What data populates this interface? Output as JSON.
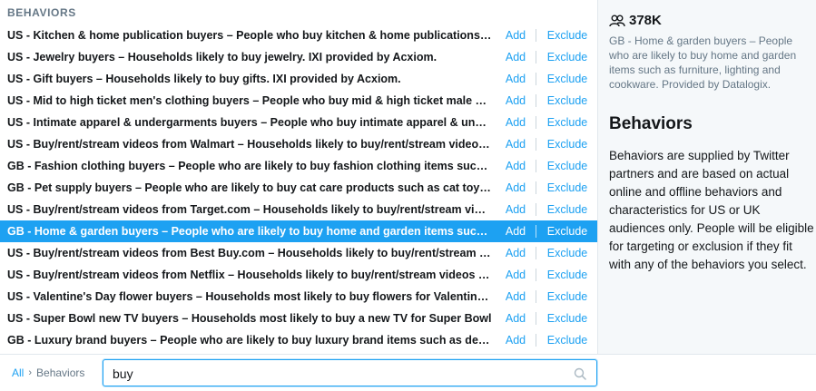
{
  "section": {
    "title": "BEHAVIORS"
  },
  "rows": [
    {
      "label": "US - Kitchen & home publication buyers – People who buy kitchen & home publications including cooking magazines",
      "add": "Add",
      "exclude": "Exclude",
      "selected": false
    },
    {
      "label": "US - Jewelry buyers – Households likely to buy jewelry. IXI provided by Acxiom.",
      "add": "Add",
      "exclude": "Exclude",
      "selected": false
    },
    {
      "label": "US - Gift buyers – Households likely to buy gifts. IXI provided by Acxiom.",
      "add": "Add",
      "exclude": "Exclude",
      "selected": false
    },
    {
      "label": "US - Mid to high ticket men's clothing buyers – People who buy mid & high ticket male clothing",
      "add": "Add",
      "exclude": "Exclude",
      "selected": false
    },
    {
      "label": "US - Intimate apparel & undergarments buyers – People who buy intimate apparel & undergarments",
      "add": "Add",
      "exclude": "Exclude",
      "selected": false
    },
    {
      "label": "US - Buy/rent/stream videos from Walmart – Households likely to buy/rent/stream videos from Walmart",
      "add": "Add",
      "exclude": "Exclude",
      "selected": false
    },
    {
      "label": "GB - Fashion clothing buyers – People who are likely to buy fashion clothing items such as dresses",
      "add": "Add",
      "exclude": "Exclude",
      "selected": false
    },
    {
      "label": "GB - Pet supply buyers – People who are likely to buy cat care products such as cat toys and food",
      "add": "Add",
      "exclude": "Exclude",
      "selected": false
    },
    {
      "label": "US - Buy/rent/stream videos from Target.com – Households likely to buy/rent/stream videos from Target.com",
      "add": "Add",
      "exclude": "Exclude",
      "selected": false
    },
    {
      "label": "GB - Home & garden buyers – People who are likely to buy home and garden items such as furniture",
      "add": "Add",
      "exclude": "Exclude",
      "selected": true
    },
    {
      "label": "US - Buy/rent/stream videos from Best Buy.com – Households likely to buy/rent/stream videos from Best Buy.com",
      "add": "Add",
      "exclude": "Exclude",
      "selected": false
    },
    {
      "label": "US - Buy/rent/stream videos from Netflix – Households likely to buy/rent/stream videos from Netflix",
      "add": "Add",
      "exclude": "Exclude",
      "selected": false
    },
    {
      "label": "US - Valentine's Day flower buyers – Households most likely to buy flowers for Valentine's Day",
      "add": "Add",
      "exclude": "Exclude",
      "selected": false
    },
    {
      "label": "US - Super Bowl new TV buyers – Households most likely to buy a new TV for Super Bowl",
      "add": "Add",
      "exclude": "Exclude",
      "selected": false
    },
    {
      "label": "GB - Luxury brand buyers – People who are likely to buy luxury brand items such as designer goods",
      "add": "Add",
      "exclude": "Exclude",
      "selected": false
    }
  ],
  "info": {
    "audience_size": "378K",
    "audience_icon": "users-icon",
    "description": "GB - Home & garden buyers – People who are likely to buy home and garden items such as furniture, lighting and cookware. Provided by Datalogix.",
    "title": "Behaviors",
    "body": "Behaviors are supplied by Twitter partners and are based on actual online and offline behaviors and characteristics for US or UK audiences only. People will be eligible for targeting or exclusion if they fit with any of the behaviors you select."
  },
  "breadcrumb": {
    "root": "All",
    "separator": "›",
    "current": "Behaviors"
  },
  "search": {
    "value": "buy",
    "icon": "search-icon"
  },
  "colors": {
    "accent": "#1da1f2",
    "muted": "#657786",
    "text": "#14171a",
    "panel_bg": "#f5f8fa"
  }
}
